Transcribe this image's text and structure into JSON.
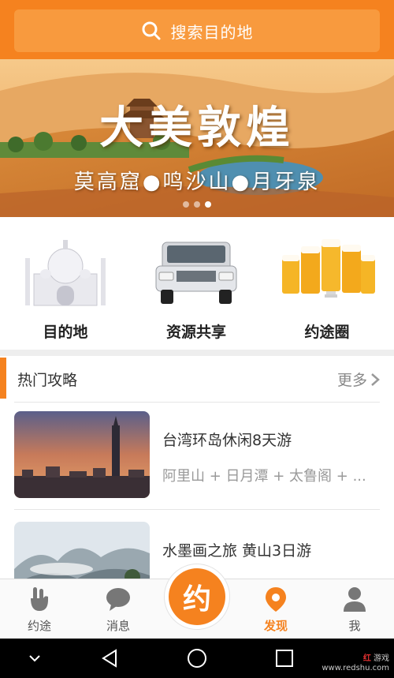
{
  "search": {
    "placeholder": "搜索目的地"
  },
  "banner": {
    "title": "大美敦煌",
    "subtitle": "莫高窟●鸣沙山●月牙泉",
    "dots": 3,
    "active_dot": 3
  },
  "categories": [
    {
      "label": "目的地",
      "icon": "taj-mahal-icon"
    },
    {
      "label": "资源共享",
      "icon": "suv-car-icon"
    },
    {
      "label": "约途圈",
      "icon": "beer-glasses-icon"
    }
  ],
  "hot_guides": {
    "title": "热门攻略",
    "more_label": "更多",
    "items": [
      {
        "title": "台湾环岛休闲8天游",
        "desc": "阿里山 + 日月潭 + 太鲁阁 + ..."
      },
      {
        "title": "水墨画之旅  黄山3日游",
        "desc": ""
      }
    ]
  },
  "tabbar": {
    "center_label": "约",
    "items": [
      {
        "label": "约途",
        "icon": "peace-hand-icon"
      },
      {
        "label": "消息",
        "icon": "chat-bubble-icon"
      },
      {
        "label": "发现",
        "icon": "location-pin-icon",
        "active": true
      },
      {
        "label": "我",
        "icon": "person-icon"
      }
    ]
  },
  "watermark": {
    "brand": "红",
    "site_label": "游戏",
    "url": "www.redshu.com"
  },
  "colors": {
    "accent": "#f5821f",
    "search_bg": "#f89a3e"
  }
}
